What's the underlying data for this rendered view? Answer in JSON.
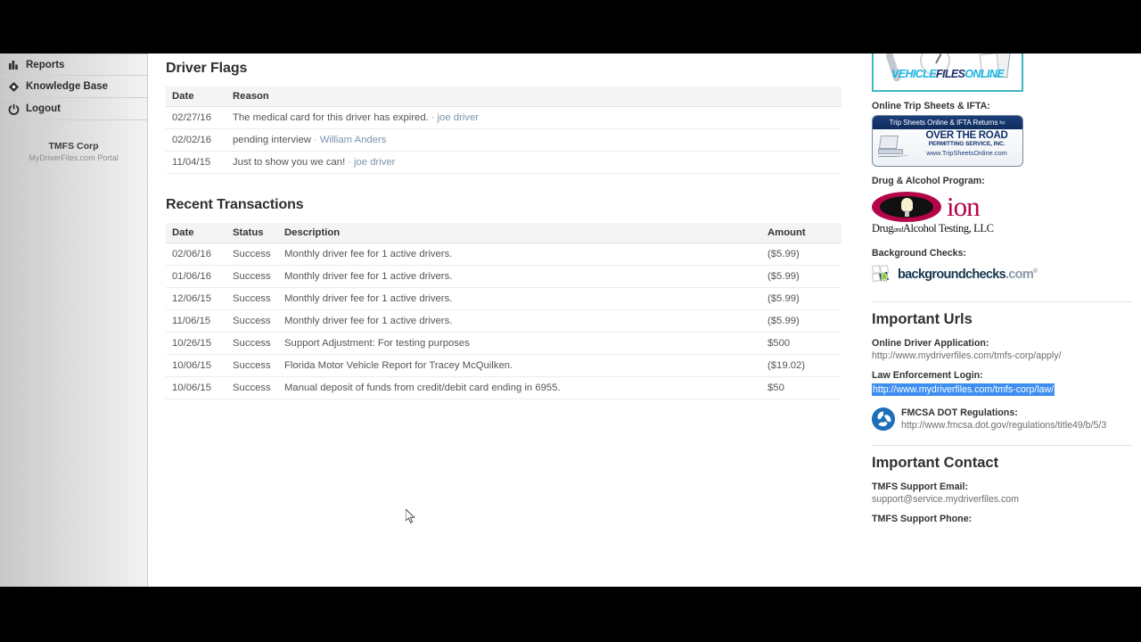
{
  "sidebar": {
    "items": [
      {
        "label": "Reports",
        "icon": "bar-chart-icon"
      },
      {
        "label": "Knowledge Base",
        "icon": "diamond-book-icon"
      },
      {
        "label": "Logout",
        "icon": "power-icon"
      }
    ],
    "brand": {
      "name": "TMFS Corp",
      "subtitle": "MyDriverFiles.com Portal"
    }
  },
  "main": {
    "driver_flags": {
      "title": "Driver Flags",
      "columns": [
        "Date",
        "Reason"
      ],
      "rows": [
        {
          "date": "02/27/16",
          "reason": "The medical card for this driver has expired.",
          "link": "joe driver"
        },
        {
          "date": "02/02/16",
          "reason": "pending interview",
          "link": "William Anders"
        },
        {
          "date": "11/04/15",
          "reason": "Just to show you we can!",
          "link": "joe driver"
        }
      ]
    },
    "recent_transactions": {
      "title": "Recent Transactions",
      "columns": [
        "Date",
        "Status",
        "Description",
        "Amount"
      ],
      "rows": [
        {
          "date": "02/06/16",
          "status": "Success",
          "description": "Monthly driver fee for 1 active drivers.",
          "amount": "($5.99)"
        },
        {
          "date": "01/06/16",
          "status": "Success",
          "description": "Monthly driver fee for 1 active drivers.",
          "amount": "($5.99)"
        },
        {
          "date": "12/06/15",
          "status": "Success",
          "description": "Monthly driver fee for 1 active drivers.",
          "amount": "($5.99)"
        },
        {
          "date": "11/06/15",
          "status": "Success",
          "description": "Monthly driver fee for 1 active drivers.",
          "amount": "($5.99)"
        },
        {
          "date": "10/26/15",
          "status": "Success",
          "description": "Support Adjustment: For testing purposes",
          "amount": "$500"
        },
        {
          "date": "10/06/15",
          "status": "Success",
          "description": "Florida Motor Vehicle Report for Tracey McQuilken.",
          "amount": "($19.02)"
        },
        {
          "date": "10/06/15",
          "status": "Success",
          "description": "Manual deposit of funds from credit/debit card ending in 6955.",
          "amount": "$50"
        }
      ]
    }
  },
  "rail": {
    "ads": {
      "vehicle_files": {
        "word1": "VEHICLE",
        "word2": "FILES",
        "word3": "ONLINE"
      },
      "trip_sheets_label": "Online Trip Sheets & IFTA:",
      "over_the_road": {
        "top_bar": "Trip Sheets Online & IFTA Returns",
        "top_bar_by": "by:",
        "line1": "OVER THE ROAD",
        "line2": "PERMITTING SERVICE, INC.",
        "line3": "www.TripSheetsOnline.com"
      },
      "drug_alcohol_label": "Drug & Alcohol Program:",
      "ion": {
        "word": "ion",
        "tagline_a": "Drug",
        "tagline_and": "and",
        "tagline_b": "Alcohol Testing, LLC"
      },
      "background_checks_label": "Background Checks:",
      "background_checks": {
        "name": "backgroundchecks",
        "tld": ".com"
      }
    },
    "important_urls": {
      "heading": "Important Urls",
      "online_driver_application_label": "Online Driver Application:",
      "online_driver_application_url": "http://www.mydriverfiles.com/tmfs-corp/apply/",
      "law_enforcement_label": "Law Enforcement Login:",
      "law_enforcement_url": "http://www.mydriverfiles.com/tmfs-corp/law/",
      "fmcsa_label": "FMCSA DOT Regulations:",
      "fmcsa_url": "http://www.fmcsa.dot.gov/regulations/title49/b/5/3"
    },
    "important_contact": {
      "heading": "Important Contact",
      "support_email_label": "TMFS Support Email:",
      "support_email": "support@service.mydriverfiles.com",
      "support_phone_label": "TMFS Support Phone:"
    }
  },
  "colors": {
    "selection_blue": "#3d8ef0",
    "link_blue": "#7a93ad",
    "accent_teal": "#3fb6c4",
    "ion_crimson": "#b5054a",
    "fmcsa_blue": "#1e6fba"
  }
}
